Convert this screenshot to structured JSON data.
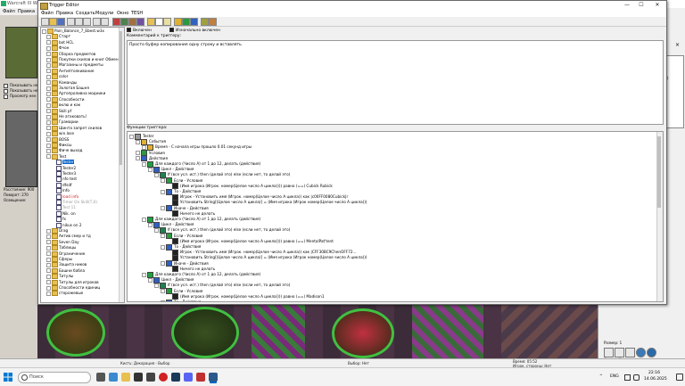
{
  "background_window": {
    "title": "Warcraft III Wo",
    "menu": [
      "Файл",
      "Правка"
    ],
    "checks": [
      "Показывать не",
      "Показывать не",
      "Просмотр нен"
    ],
    "labels": [
      "Расстояние: 900",
      "Поворот:   270",
      "Освещение:"
    ],
    "status_left": "Кисть: Декорация - Выбор",
    "status_mid": "Выбор: Нет",
    "status_right": [
      "Время: 05:52",
      "Игрок, стороны: Нет"
    ],
    "right_panel": {
      "close_mark": "×",
      "textbox_hint": "метов.)",
      "size_label": "Размер: 1",
      "shape_label": "Форма: Круг"
    }
  },
  "trigger_editor": {
    "title": "Trigger Editor",
    "menu": [
      "Файл",
      "Правка",
      "Создать",
      "Модули",
      "Окно",
      "TESH"
    ],
    "enabled_label": "Включен",
    "initially_enabled_label": "Изначально включен",
    "comment_label": "Комментарий к триггеру:",
    "comment_text": "Просто буфер копирования одну строку и вставлять",
    "functions_label": "Функции триггера:",
    "tree": [
      {
        "label": "Pain_Balance_7_Ebest.w3x",
        "indent": 0,
        "kind": "root"
      },
      {
        "label": "Старт",
        "indent": 1,
        "kind": "folder"
      },
      {
        "label": "bot HCL",
        "indent": 1,
        "kind": "folder"
      },
      {
        "label": "Фчон",
        "indent": 1,
        "kind": "folder"
      },
      {
        "label": "Сборка предметов",
        "indent": 1,
        "kind": "folder"
      },
      {
        "label": "Покупки скилов и книг Обмен предм",
        "indent": 1,
        "kind": "folder"
      },
      {
        "label": "Магазины и предметы",
        "indent": 1,
        "kind": "folder"
      },
      {
        "label": "Антиптолкивание",
        "indent": 1,
        "kind": "folder"
      },
      {
        "label": "color",
        "indent": 1,
        "kind": "folder"
      },
      {
        "label": "Команды",
        "indent": 1,
        "kind": "folder"
      },
      {
        "label": "Золотая Башня",
        "indent": 1,
        "kind": "folder"
      },
      {
        "label": "Артопроливна модники",
        "indent": 1,
        "kind": "folder"
      },
      {
        "label": "Способности",
        "indent": 1,
        "kind": "folder"
      },
      {
        "label": "вклю и как",
        "indent": 1,
        "kind": "folder"
      },
      {
        "label": "Skill pf",
        "indent": 1,
        "kind": "folder"
      },
      {
        "label": "Не атаковать!",
        "indent": 1,
        "kind": "folder"
      },
      {
        "label": "Грамарии",
        "indent": 1,
        "kind": "folder"
      },
      {
        "label": "Шинта запрет скилов",
        "indent": 1,
        "kind": "folder"
      },
      {
        "label": "win.lose",
        "indent": 1,
        "kind": "folder"
      },
      {
        "label": "BOSS",
        "indent": 1,
        "kind": "folder"
      },
      {
        "label": "Фиксы",
        "indent": 1,
        "kind": "folder"
      },
      {
        "label": "Фиче выход",
        "indent": 1,
        "kind": "folder"
      },
      {
        "label": "Test",
        "indent": 1,
        "kind": "folder"
      },
      {
        "label": "Tester",
        "indent": 2,
        "kind": "trigger",
        "state": "selected"
      },
      {
        "label": "Tester2",
        "indent": 2,
        "kind": "trigger"
      },
      {
        "label": "Tester3",
        "indent": 2,
        "kind": "trigger"
      },
      {
        "label": "nfo test",
        "indent": 2,
        "kind": "trigger"
      },
      {
        "label": "dfsdf",
        "indent": 2,
        "kind": "trigger"
      },
      {
        "label": "Info",
        "indent": 2,
        "kind": "trigger"
      },
      {
        "label": "load info",
        "indent": 2,
        "kind": "trigger",
        "state": "red"
      },
      {
        "label": "Timer On Skill(T,0)",
        "indent": 2,
        "kind": "trigger",
        "state": "disabled"
      },
      {
        "label": "Test 11",
        "indent": 2,
        "kind": "trigger",
        "state": "disabled"
      },
      {
        "label": "Nik. on",
        "indent": 2,
        "kind": "trigger"
      },
      {
        "label": "fx",
        "indent": 2,
        "kind": "trigger"
      },
      {
        "label": "nikus on 2",
        "indent": 2,
        "kind": "trigger"
      },
      {
        "label": "Drag",
        "indent": 1,
        "kind": "folder"
      },
      {
        "label": "Актив смер и тд",
        "indent": 1,
        "kind": "folder"
      },
      {
        "label": "Seven Day",
        "indent": 1,
        "kind": "folder"
      },
      {
        "label": "Таблицы",
        "indent": 1,
        "kind": "folder"
      },
      {
        "label": "Ограничение",
        "indent": 1,
        "kind": "folder"
      },
      {
        "label": "Сферы",
        "indent": 1,
        "kind": "folder"
      },
      {
        "label": "Защита ников",
        "indent": 1,
        "kind": "folder"
      },
      {
        "label": "Башни бабла",
        "indent": 1,
        "kind": "folder"
      },
      {
        "label": "Титулы",
        "indent": 1,
        "kind": "folder"
      },
      {
        "label": "Титулы для игроков",
        "indent": 1,
        "kind": "folder"
      },
      {
        "label": "Способности единиц",
        "indent": 1,
        "kind": "folder"
      },
      {
        "label": "сторожевые",
        "indent": 1,
        "kind": "folder"
      }
    ],
    "functions": [
      {
        "text": "Tester",
        "indent": 0,
        "icon": "root"
      },
      {
        "text": "События",
        "indent": 1,
        "icon": "ev"
      },
      {
        "text": "Время - С начала игры прошло 0.01 секунд игры",
        "indent": 2,
        "icon": "ev"
      },
      {
        "text": "Условия",
        "indent": 1,
        "icon": "cond"
      },
      {
        "text": "Действия",
        "indent": 1,
        "icon": "act"
      },
      {
        "text": "Для каждого (Число А) от 1 до 12, делать (действия)",
        "indent": 2,
        "icon": "loop"
      },
      {
        "text": "Цикл - Действия",
        "indent": 3,
        "icon": "act"
      },
      {
        "text": "If (все усл. ист.) then (делай это) else (если нет, то делай это)",
        "indent": 4,
        "icon": "if"
      },
      {
        "text": "Если - Условия",
        "indent": 5,
        "icon": "cond"
      },
      {
        "text": "(Имя игрока (Игрок. номер(Целое число А цикла)))) равно (==) Cubick Rubick",
        "indent": 6,
        "icon": "fn"
      },
      {
        "text": "То - Действия",
        "indent": 5,
        "icon": "act"
      },
      {
        "text": "Игрок - Установить имя (Игрок. номер(Целое число А цикла)) как |c00FF0080Cubick|r",
        "indent": 6,
        "icon": "fn"
      },
      {
        "text": "Установить String[(Целое число А цикла)] = (Имя игрока (Игрок номер(Целое число А цикла)))",
        "indent": 6,
        "icon": "fn"
      },
      {
        "text": "Иначе - Действия",
        "indent": 5,
        "icon": "act"
      },
      {
        "text": "Ничего не делать",
        "indent": 6,
        "icon": "fn"
      },
      {
        "text": "Для каждого (Число А) от 1 до 12, делать (действия)",
        "indent": 2,
        "icon": "loop"
      },
      {
        "text": "Цикл - Действия",
        "indent": 3,
        "icon": "act"
      },
      {
        "text": "If (все усл. ист.) then (делай это) else (если нет, то делай это)",
        "indent": 4,
        "icon": "if"
      },
      {
        "text": "Если - Условия",
        "indent": 5,
        "icon": "cond"
      },
      {
        "text": "(Имя игрока (Игрок. номер(Целое число А цикла)))) равно (==) MentalPat'tent",
        "indent": 6,
        "icon": "fn"
      },
      {
        "text": "То - Действия",
        "indent": 5,
        "icon": "act"
      },
      {
        "text": "Игрок - Установить имя (Игрок. номер(Целое число А цикла)) как |CFF30BC9ChenOFF72...",
        "indent": 6,
        "icon": "fn"
      },
      {
        "text": "Установить String[(Целое число А цикла)] = (Имя игрока (Игрок номер(Целое число А цикла)))",
        "indent": 6,
        "icon": "fn"
      },
      {
        "text": "Иначе - Действия",
        "indent": 5,
        "icon": "act"
      },
      {
        "text": "Ничего не делать",
        "indent": 6,
        "icon": "fn"
      },
      {
        "text": "Для каждого (Число А) от 1 до 12, делать (действия)",
        "indent": 2,
        "icon": "loop"
      },
      {
        "text": "Цикл - Действия",
        "indent": 3,
        "icon": "act"
      },
      {
        "text": "If (все усл. ист.) then (делай это) else (если нет, то делай это)",
        "indent": 4,
        "icon": "if"
      },
      {
        "text": "Если - Условия",
        "indent": 5,
        "icon": "cond"
      },
      {
        "text": "(Имя игрока (Игрок. номер(Целое число А цикла)))) равно (==) Madison1",
        "indent": 6,
        "icon": "fn"
      },
      {
        "text": "То - Действия",
        "indent": 5,
        "icon": "act"
      },
      {
        "text": "Игрок - Установить имя (Игрок. номер(Целое число А цикла)) как |c00FF0080Madis0064...",
        "indent": 6,
        "icon": "fn"
      },
      {
        "text": "Установить String[(Целое число А цикла)] = (Имя игрока (Игрок номер(Целое число А цикла)))",
        "indent": 6,
        "icon": "fn"
      },
      {
        "text": "Иначе - Действия",
        "indent": 5,
        "icon": "act"
      }
    ]
  },
  "taskbar": {
    "search_placeholder": "Поиск",
    "language": "ENG",
    "time": "22:16",
    "date": "14.06.2025"
  },
  "colors": {
    "selection": "#0a64c8",
    "accent": "#0067c0"
  }
}
